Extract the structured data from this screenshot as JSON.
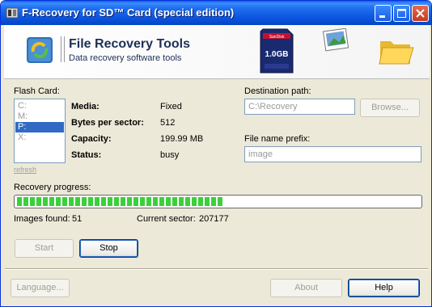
{
  "window": {
    "title": "F-Recovery for SD™ Card (special edition)"
  },
  "header": {
    "logo_title": "File Recovery Tools",
    "logo_subtitle": "Data recovery software tools",
    "sd_card_brand": "SanDisk",
    "sd_card_capacity": "1.0GB"
  },
  "flash_card": {
    "label": "Flash Card:",
    "drives": [
      "C:",
      "M:",
      "P:",
      "X:"
    ],
    "selected": "P:",
    "refresh_link": "refresh"
  },
  "info": {
    "media_label": "Media:",
    "media_value": "Fixed",
    "bps_label": "Bytes per sector:",
    "bps_value": "512",
    "capacity_label": "Capacity:",
    "capacity_value": "199.99 MB",
    "status_label": "Status:",
    "status_value": "busy"
  },
  "destination": {
    "label": "Destination path:",
    "value": "C:\\Recovery",
    "browse_label": "Browse..."
  },
  "prefix": {
    "label": "File name prefix:",
    "value": "image"
  },
  "progress": {
    "label": "Recovery progress:",
    "fraction": 0.51
  },
  "stats": {
    "images_label": "Images found:",
    "images_value": "51",
    "sector_label": "Current sector:",
    "sector_value": "207177"
  },
  "buttons": {
    "start": "Start",
    "stop": "Stop",
    "language": "Language...",
    "about": "About",
    "help": "Help"
  },
  "colors": {
    "titlebar": "#0a5fe8",
    "progress": "#3bd03b",
    "selection": "#316ac5"
  }
}
